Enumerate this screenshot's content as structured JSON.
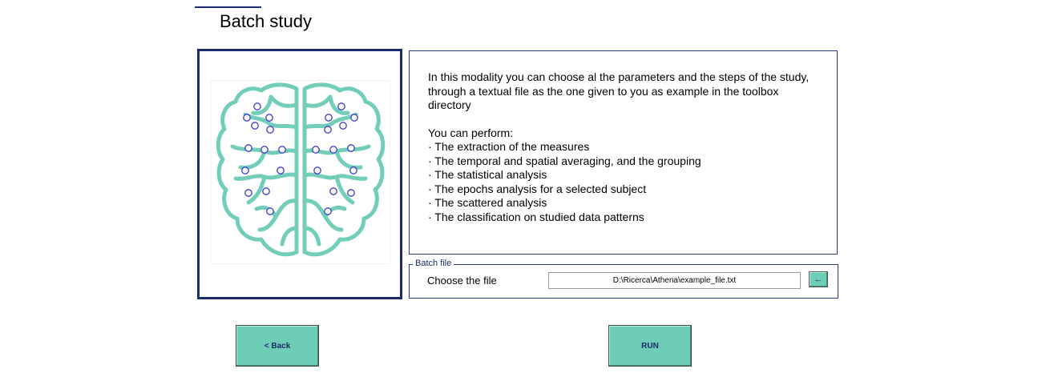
{
  "page": {
    "title": "Batch study"
  },
  "description": {
    "intro": "In this modality you can choose al the parameters and the steps of the study, through a textual file as the one given to you as example in the toolbox directory",
    "perform_heading": "You can perform:",
    "perform_items": [
      "· The extraction of the measures",
      "· The temporal and spatial averaging, and the grouping",
      "· The statistical analysis",
      "· The epochs analysis for a selected subject",
      "· The scattered analysis",
      "· The classification on studied data patterns"
    ]
  },
  "batch_file": {
    "legend": "Batch file",
    "choose_label": "Choose the file",
    "file_path": "D:\\Ricerca\\Athena\\example_file.txt",
    "browse_glyph": "←"
  },
  "buttons": {
    "back": "<  Back",
    "run": "RUN"
  },
  "colors": {
    "accent": "#6ecdb7",
    "frame": "#1b2a6b",
    "brain": "#72cdb9",
    "electrode": "#3b3bc8"
  },
  "icons": {
    "brain_image": "brain-electrodes-icon"
  }
}
